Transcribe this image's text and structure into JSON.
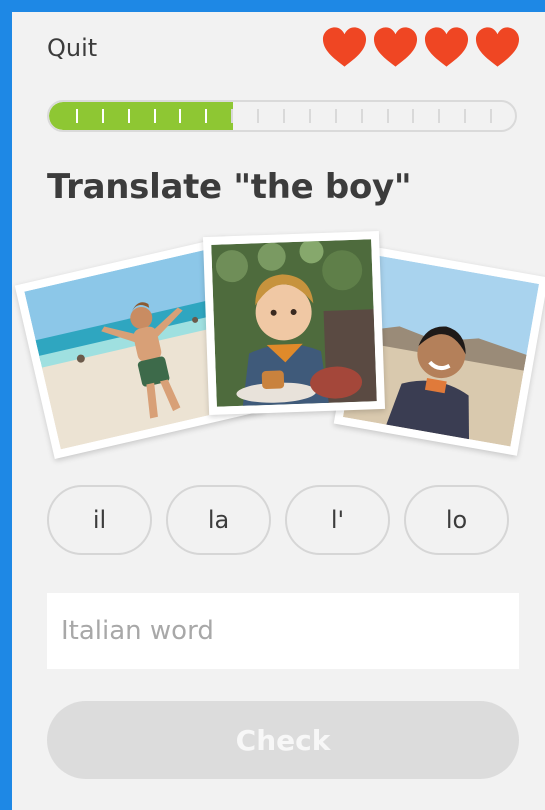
{
  "header": {
    "quit_label": "Quit",
    "lives": 4,
    "heart_color": "#ef4623"
  },
  "progress": {
    "completed_fraction": 0.395,
    "fill_color": "#8ec733",
    "segments": 18,
    "completed_segments": 7
  },
  "prompt": {
    "text": "Translate \"the boy\""
  },
  "images": [
    {
      "name": "beach-boy-photo",
      "icon": "photo-boy-on-beach"
    },
    {
      "name": "toddler-boy-photo",
      "icon": "photo-toddler-boy"
    },
    {
      "name": "smiling-boy-photo",
      "icon": "photo-smiling-boy"
    }
  ],
  "choices": [
    "il",
    "la",
    "l'",
    "lo"
  ],
  "answer": {
    "placeholder": "Italian word",
    "value": ""
  },
  "check_label": "Check",
  "colors": {
    "frame_border": "#1e88e5",
    "background": "#f2f2f2",
    "text": "#3c3c3c"
  }
}
